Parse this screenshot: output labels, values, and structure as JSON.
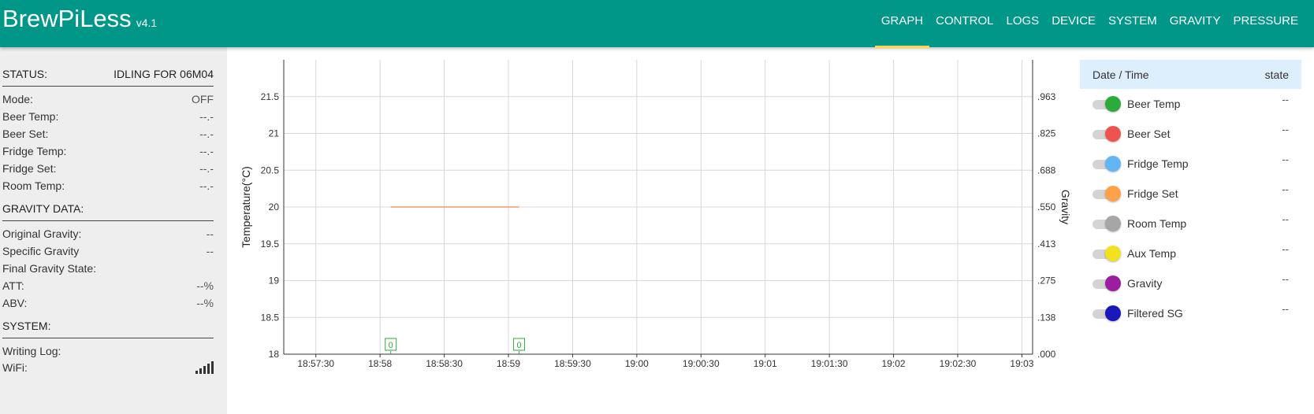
{
  "app": {
    "title": "BrewPiLess",
    "version": "v4.1"
  },
  "nav": [
    {
      "label": "GRAPH",
      "active": true
    },
    {
      "label": "CONTROL",
      "active": false
    },
    {
      "label": "LOGS",
      "active": false
    },
    {
      "label": "DEVICE",
      "active": false
    },
    {
      "label": "SYSTEM",
      "active": false
    },
    {
      "label": "GRAVITY",
      "active": false
    },
    {
      "label": "PRESSURE",
      "active": false
    }
  ],
  "status": {
    "label": "STATUS:",
    "value": "IDLING FOR 06M04"
  },
  "temps": [
    {
      "label": "Mode:",
      "value": "OFF"
    },
    {
      "label": "Beer Temp:",
      "value": "--.-"
    },
    {
      "label": "Beer Set:",
      "value": "--.-"
    },
    {
      "label": "Fridge Temp:",
      "value": "--.-"
    },
    {
      "label": "Fridge Set:",
      "value": "--.-"
    },
    {
      "label": "Room Temp:",
      "value": "--.-"
    }
  ],
  "gravity_section": {
    "title": "GRAVITY DATA:",
    "rows": [
      {
        "label": "Original Gravity:",
        "value": "--"
      },
      {
        "label": "Specific Gravity",
        "value": "--"
      },
      {
        "label": "Final Gravity State:",
        "value": ""
      },
      {
        "label": "ATT:",
        "value": "--%"
      },
      {
        "label": "ABV:",
        "value": "--%"
      }
    ]
  },
  "system_section": {
    "title": "SYSTEM:",
    "rows": [
      {
        "label": "Writing Log:",
        "value": ""
      },
      {
        "label": "WiFi:",
        "icon": "wifi-signal-icon"
      }
    ]
  },
  "legend": {
    "header": {
      "col1": "Date / Time",
      "col2": "state"
    },
    "items": [
      {
        "label": "Beer Temp",
        "color": "#2eaa3c",
        "state": "--"
      },
      {
        "label": "Beer Set",
        "color": "#ef5350",
        "state": "--"
      },
      {
        "label": "Fridge Temp",
        "color": "#64b5f6",
        "state": "--"
      },
      {
        "label": "Fridge Set",
        "color": "#ffa04a",
        "state": "--"
      },
      {
        "label": "Room Temp",
        "color": "#a6a6a6",
        "state": "--"
      },
      {
        "label": "Aux Temp",
        "color": "#f2e21e",
        "state": "--"
      },
      {
        "label": "Gravity",
        "color": "#9c1ea0",
        "state": "--"
      },
      {
        "label": "Filtered SG",
        "color": "#1a18b8",
        "state": "--"
      }
    ]
  },
  "chart_data": {
    "type": "line",
    "ylabel": "Temperature(°C)",
    "y2label": "Gravity",
    "ylim": [
      18,
      22
    ],
    "y_ticks": [
      "18",
      "18.5",
      "19",
      "19.5",
      "20",
      "20.5",
      "21",
      "21.5"
    ],
    "y_tick_values": [
      18,
      18.5,
      19,
      19.5,
      20,
      20.5,
      21,
      21.5
    ],
    "y2_ticks": [
      ".000",
      ".138",
      ".275",
      ".413",
      ".550",
      ".688",
      ".825",
      ".963"
    ],
    "x_ticks": [
      "18:57:30",
      "18:58",
      "18:58:30",
      "18:59",
      "18:59:30",
      "19:00",
      "19:00:30",
      "19:01",
      "19:01:30",
      "19:02",
      "19:02:30",
      "19:03"
    ],
    "x_range": [
      "18:57:15",
      "19:03:05"
    ],
    "grid": true,
    "series": [
      {
        "color": "#ff7f50",
        "x": [
          "18:58:05",
          "18:59:05"
        ],
        "y": [
          20,
          20
        ]
      }
    ],
    "annotations": [
      {
        "label": "0",
        "x": "18:58:05",
        "color": "#2eaa3c"
      },
      {
        "label": "0",
        "x": "18:59:05",
        "color": "#2eaa3c"
      }
    ]
  }
}
